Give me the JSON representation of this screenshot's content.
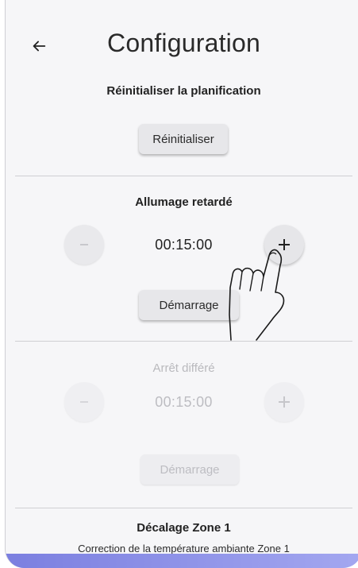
{
  "header": {
    "title": "Configuration",
    "back_icon": "arrow-left-icon"
  },
  "reset_section": {
    "title": "Réinitialiser la planification",
    "button_label": "Réinitialiser"
  },
  "delayed_start": {
    "title": "Allumage retardé",
    "time": "00:15:00",
    "minus_icon": "minus-icon",
    "plus_icon": "plus-icon",
    "start_label": "Démarrage"
  },
  "delayed_stop": {
    "title": "Arrêt différé",
    "time": "00:15:00",
    "start_label": "Démarrage",
    "disabled": true
  },
  "zone_offset": {
    "title": "Décalage Zone 1",
    "subtitle": "Correction de la température ambiante Zone 1"
  },
  "colors": {
    "background": "#f6f6f8",
    "button": "#e7e7ea",
    "disabled_text": "#bdbdc2",
    "accent_bottom": "#7b7fe0"
  }
}
